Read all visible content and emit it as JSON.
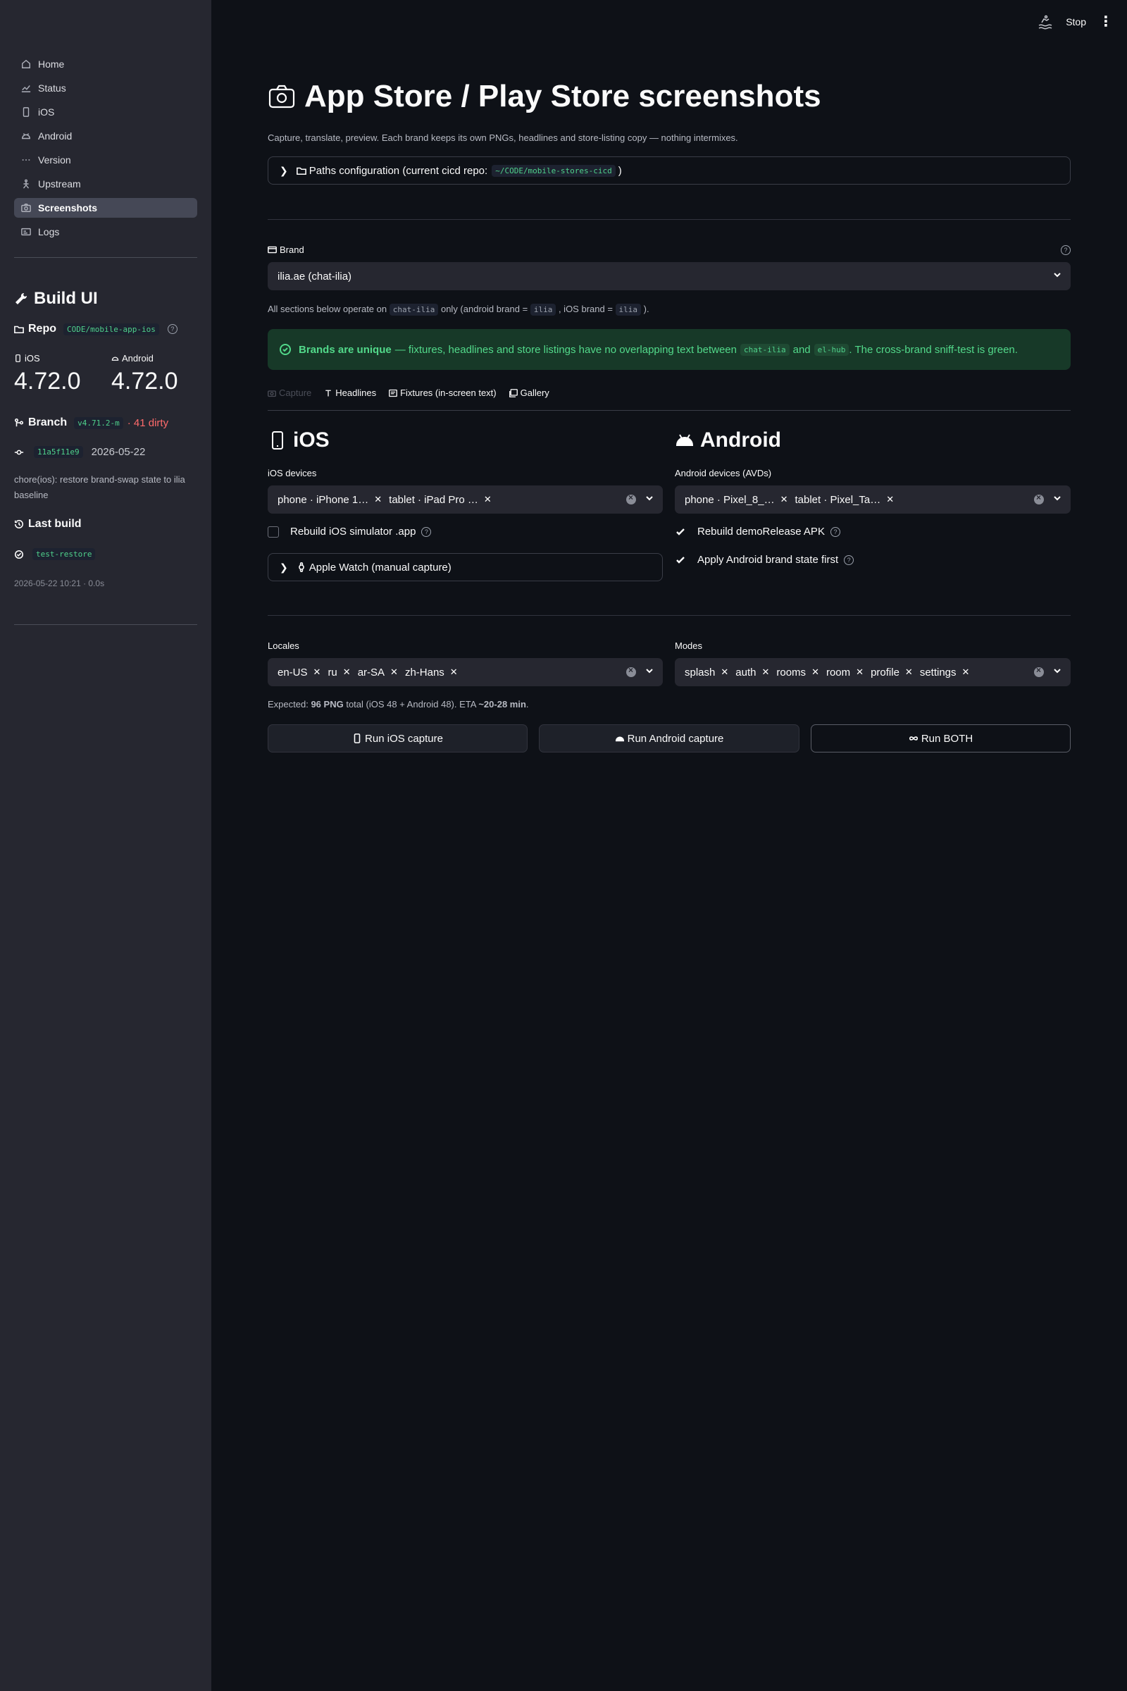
{
  "sidebar": {
    "nav": [
      {
        "label": "Home",
        "icon": "home-icon"
      },
      {
        "label": "Status",
        "icon": "chart-icon"
      },
      {
        "label": "iOS",
        "icon": "phone-icon"
      },
      {
        "label": "Android",
        "icon": "android-icon"
      },
      {
        "label": "Version",
        "icon": "version-icon"
      },
      {
        "label": "Upstream",
        "icon": "upstream-icon"
      },
      {
        "label": "Screenshots",
        "icon": "camera-icon",
        "active": true
      },
      {
        "label": "Logs",
        "icon": "logs-icon"
      }
    ],
    "title": "Build UI",
    "repo_label": "Repo",
    "repo_value": "CODE/mobile-app-ios",
    "ios_label": "iOS",
    "ios_version": "4.72.0",
    "android_label": "Android",
    "android_version": "4.72.0",
    "branch_label": "Branch",
    "branch_value": "v4.71.2-m",
    "dirty_text": "· 41 dirty",
    "commit_hash": "11a5f11e9",
    "commit_date": "2026-05-22",
    "commit_message": "chore(ios): restore brand-swap state to ilia baseline",
    "last_build_label": "Last build",
    "last_build_name": "test-restore",
    "last_build_time": "2026-05-22 10:21 · 0.0s"
  },
  "topbar": {
    "stop_label": "Stop"
  },
  "main": {
    "title": "App Store / Play Store screenshots",
    "subtitle": "Capture, translate, preview. Each brand keeps its own PNGs, headlines and store-listing copy — nothing intermixes.",
    "paths_expander": "Paths configuration (current cicd repo:",
    "paths_repo": "~/CODE/mobile-stores-cicd",
    "paths_close": ")",
    "brand_label": "Brand",
    "brand_value": "ilia.ae (chat-ilia)",
    "brand_note_1": "All sections below operate on",
    "brand_note_code1": "chat-ilia",
    "brand_note_2": "only (android brand =",
    "brand_note_code2": "ilia",
    "brand_note_3": ", iOS brand =",
    "brand_note_code3": "ilia",
    "brand_note_4": ").",
    "success_bold": "Brands are unique",
    "success_text1": "— fixtures, headlines and store listings have no overlapping text between",
    "success_code1": "chat-ilia",
    "success_and": "and",
    "success_code2": "el-hub",
    "success_text2": ". The cross-brand sniff-test is green.",
    "tabs": [
      {
        "label": "Capture",
        "disabled": true
      },
      {
        "label": "Headlines"
      },
      {
        "label": "Fixtures (in-screen text)"
      },
      {
        "label": "Gallery"
      }
    ],
    "ios": {
      "heading": "iOS",
      "devices_label": "iOS devices",
      "devices": [
        "phone · iPhone 1…",
        "tablet · iPad Pro …"
      ],
      "rebuild_label": "Rebuild iOS simulator .app",
      "watch_label": "Apple Watch (manual capture)"
    },
    "android": {
      "heading": "Android",
      "devices_label": "Android devices (AVDs)",
      "devices": [
        "phone · Pixel_8_…",
        "tablet · Pixel_Ta…"
      ],
      "rebuild_label": "Rebuild demoRelease APK",
      "apply_label": "Apply Android brand state first"
    },
    "locales_label": "Locales",
    "locales": [
      "en-US",
      "ru",
      "ar-SA",
      "zh-Hans"
    ],
    "modes_label": "Modes",
    "modes": [
      "splash",
      "auth",
      "rooms",
      "room",
      "profile",
      "settings"
    ],
    "expected_1": "Expected:",
    "expected_bold1": "96 PNG",
    "expected_2": "total (iOS 48 + Android 48). ETA",
    "expected_bold2": "~20-28 min",
    "expected_3": ".",
    "btn_ios": "Run iOS capture",
    "btn_android": "Run Android capture",
    "btn_both": "Run BOTH"
  },
  "colors": {
    "background": "#0e1117",
    "sidebar": "#262730",
    "success": "#52d98a",
    "danger": "#ff6b6b"
  }
}
